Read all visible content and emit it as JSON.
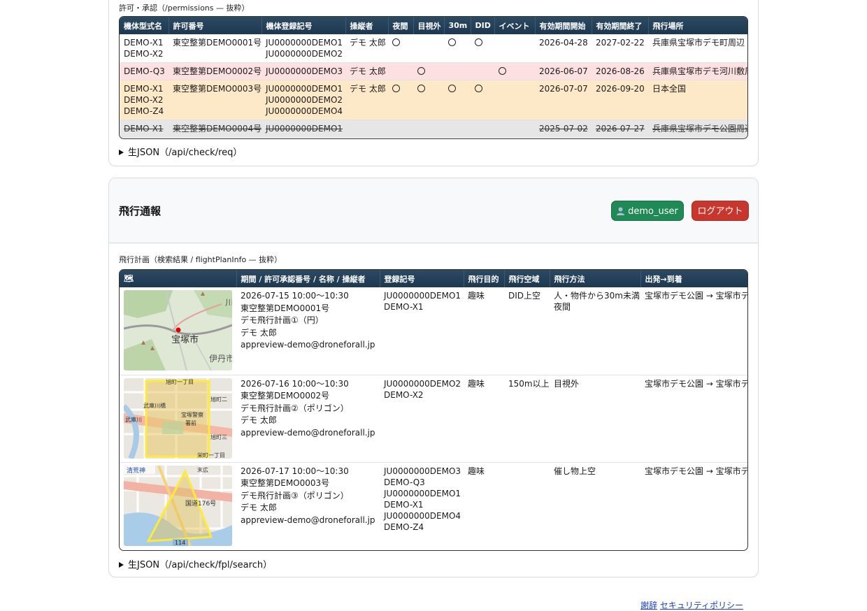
{
  "permissions": {
    "caption": "許可・承認（/permissions — 抜粋）",
    "columns": [
      "機体型式名",
      "許可番号",
      "機体登録記号",
      "操縦者",
      "夜間",
      "目視外",
      "30m",
      "DID",
      "イベント",
      "有効期間開始",
      "有効期間終了",
      "飛行場所"
    ],
    "mark": "〇",
    "rows": [
      {
        "models": [
          "DEMO-X1",
          "DEMO-X2"
        ],
        "permit": "東空整第DEMO0001号",
        "regs": [
          "JU0000000DEMO1",
          "JU0000000DEMO2"
        ],
        "pilot": "デモ 太郎",
        "night": true,
        "bvlos": false,
        "m30": true,
        "did": true,
        "event": false,
        "start": "2026-04-28",
        "end": "2027-02-22",
        "place": "兵庫県宝塚市デモ町周辺"
      },
      {
        "models": [
          "DEMO-Q3"
        ],
        "permit": "東空整第DEMO0002号",
        "regs": [
          "JU0000000DEMO3"
        ],
        "pilot": "デモ 太郎",
        "night": false,
        "bvlos": true,
        "m30": false,
        "did": false,
        "event": true,
        "start": "2026-06-07",
        "end": "2026-08-26",
        "place": "兵庫県宝塚市デモ河川敷周辺"
      },
      {
        "models": [
          "DEMO-X1",
          "DEMO-X2",
          "DEMO-Z4"
        ],
        "permit": "東空整第DEMO0003号",
        "regs": [
          "JU0000000DEMO1",
          "JU0000000DEMO2",
          "JU0000000DEMO4"
        ],
        "pilot": "デモ 太郎",
        "night": true,
        "bvlos": true,
        "m30": true,
        "did": true,
        "event": false,
        "start": "2026-07-07",
        "end": "2026-09-20",
        "place": "日本全国"
      },
      {
        "models": [
          "DEMO-X1"
        ],
        "permit": "東空整第DEMO0004号",
        "regs": [
          "JU0000000DEMO1"
        ],
        "pilot": "",
        "night": false,
        "bvlos": false,
        "m30": false,
        "did": false,
        "event": false,
        "start": "2025-07-02",
        "end": "2026-07-27",
        "place": "兵庫県宝塚市デモ公園周辺"
      }
    ],
    "raw_json_label": "生JSON（/api/check/req）"
  },
  "flight_report": {
    "title": "飛行通報",
    "user_icon": "person-icon",
    "user_label": "demo_user",
    "logout_label": "ログアウト",
    "caption": "飛行計画（検索結果 / flightPlanInfo — 抜粋）",
    "columns": [
      "🗺",
      "期間 / 許可承認番号 / 名称 / 操縦者",
      "登録記号",
      "飛行目的",
      "飛行空域",
      "飛行方法",
      "出発→到着"
    ],
    "plans": [
      {
        "map_labels": [
          "宝塚市",
          "伊丹市",
          "川"
        ],
        "period": "2026-07-15 10:00〜10:30",
        "permit": "東空整第DEMO0001号",
        "name": "デモ飛行計画①（円）",
        "pilot": "デモ 太郎",
        "email": "appreview-demo@droneforall.jp",
        "regs": [
          "JU0000000DEMO1",
          "DEMO-X1"
        ],
        "purpose": "趣味",
        "airspace": "DID上空",
        "methods": [
          "人・物件から30m未満",
          "夜間"
        ],
        "route": "宝塚市デモ公園 → 宝塚市デモ公園"
      },
      {
        "map_labels": [
          "旭町一丁目",
          "旭町二",
          "宝塚警察",
          "署前",
          "旭町三",
          "武庫川橋",
          "武庫川",
          "栄町一丁目"
        ],
        "period": "2026-07-16 10:00〜10:30",
        "permit": "東空整第DEMO0002号",
        "name": "デモ飛行計画②（ポリゴン）",
        "pilot": "デモ 太郎",
        "email": "appreview-demo@droneforall.jp",
        "regs": [
          "JU0000000DEMO2",
          "DEMO-X2"
        ],
        "purpose": "趣味",
        "airspace": "150m以上",
        "methods": [
          "目視外"
        ],
        "route": "宝塚市デモ公園 → 宝塚市デモ公園"
      },
      {
        "map_labels": [
          "清荒神",
          "末広",
          "国道176号",
          "114"
        ],
        "period": "2026-07-17 10:00〜10:30",
        "permit": "東空整第DEMO0003号",
        "name": "デモ飛行計画③（ポリゴン）",
        "pilot": "デモ 太郎",
        "email": "appreview-demo@droneforall.jp",
        "regs": [
          "JU0000000DEMO3",
          "DEMO-Q3",
          "JU0000000DEMO1",
          "DEMO-X1",
          "JU0000000DEMO4",
          "DEMO-Z4"
        ],
        "purpose": "趣味",
        "airspace": "",
        "methods": [
          "催し物上空"
        ],
        "route": "宝塚市デモ公園 → 宝塚市デモ公園"
      }
    ],
    "raw_json_label": "生JSON（/api/check/fpl/search）"
  },
  "footer": {
    "thanks": "謝辞",
    "security": "セキュリティポリシー"
  }
}
